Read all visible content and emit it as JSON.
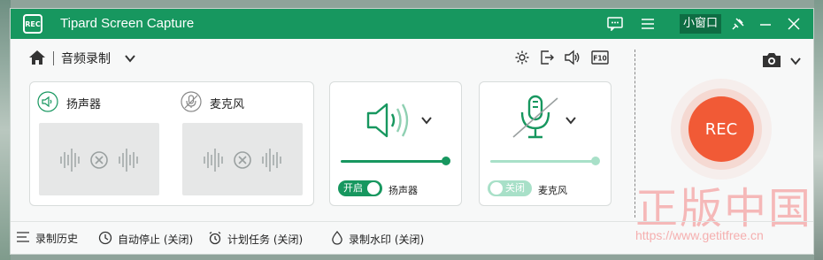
{
  "app": {
    "title": "Tipard Screen Capture",
    "logo_text": "REC"
  },
  "titlebar": {
    "mini_window_label": "小窗口"
  },
  "toolbar": {
    "mode_label": "音频录制"
  },
  "system_audio": {
    "label": "扬声器",
    "toggle_label": "开启",
    "toggle_state": "on",
    "volume": 1.0,
    "caption": "扬声器"
  },
  "microphone": {
    "label": "麦克风",
    "toggle_label": "关闭",
    "toggle_state": "off",
    "volume": 1.0,
    "caption": "麦克风"
  },
  "record_button": {
    "label": "REC"
  },
  "bottom": {
    "history": "录制历史",
    "auto_stop": "自动停止 (关闭)",
    "schedule": "计划任务 (关闭)",
    "watermark": "录制水印 (关闭)"
  },
  "watermark": {
    "text": "正版中国",
    "url": "https://www.getitfree.cn"
  },
  "colors": {
    "brand": "#17975f",
    "rec": "#f15a36",
    "toggle_on": "#17975f",
    "toggle_off": "#a8e0c8"
  },
  "icons": [
    "home-icon",
    "chevron-down-icon",
    "gear-icon",
    "export-icon",
    "speaker-icon",
    "f10-icon",
    "camera-icon",
    "feedback-icon",
    "menu-icon",
    "pin-icon",
    "minimize-icon",
    "close-icon",
    "microphone-icon",
    "list-icon",
    "clock-icon",
    "alarm-icon",
    "drop-icon"
  ]
}
